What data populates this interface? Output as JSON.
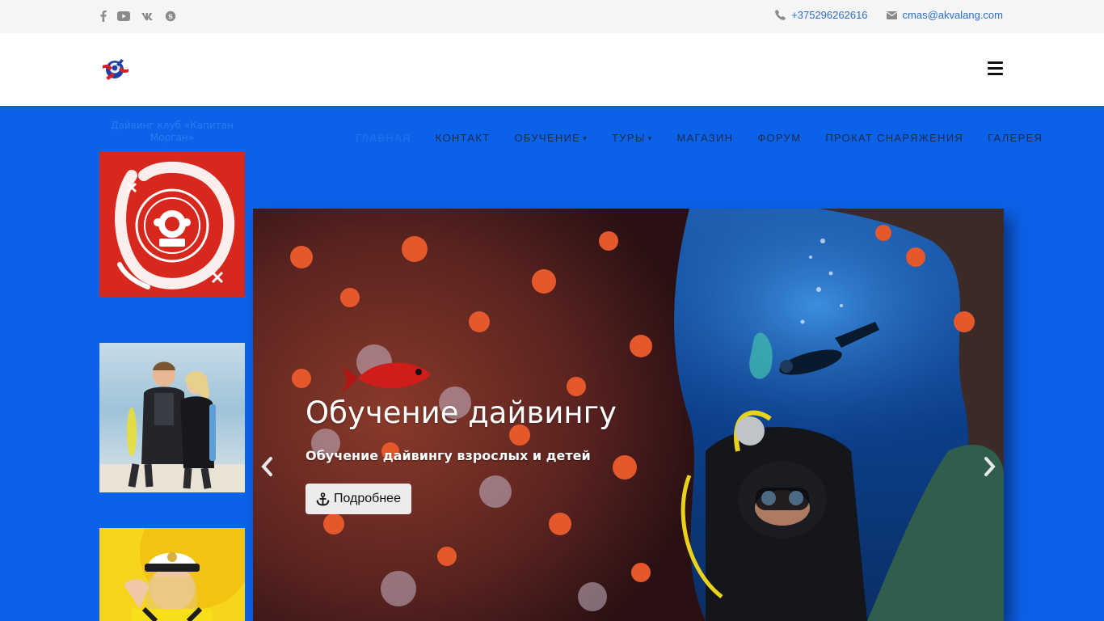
{
  "topbar": {
    "social": [
      "facebook-icon",
      "youtube-icon",
      "vk-icon",
      "skype-icon"
    ],
    "phone": "+375296262616",
    "email": "cmas@akvalang.com"
  },
  "header": {
    "menu_icon": "hamburger-icon"
  },
  "nav": {
    "items": [
      {
        "label": "ГЛАВНАЯ",
        "active": true
      },
      {
        "label": "КОНТАКТ"
      },
      {
        "label": "ОБУЧЕНИЕ",
        "dropdown": true
      },
      {
        "label": "ТУРЫ",
        "dropdown": true
      },
      {
        "label": "МАГАЗИН"
      },
      {
        "label": "ФОРУМ"
      },
      {
        "label": "ПРОКАТ СНАРЯЖЕНИЯ"
      },
      {
        "label": "ГАЛЕРЕЯ"
      }
    ]
  },
  "sidebar": {
    "caption": "Дайвинг клуб «Капитан Морган»",
    "logo_badge_text": "Белорусский подводный клуб КАПИТАН МОРГАН"
  },
  "slider": {
    "title": "Обучение дайвингу",
    "subtitle": "Обучение дайвингу взрослых и детей",
    "button_label": "Подробнее"
  },
  "colors": {
    "page_bg": "#0b62e8",
    "topbar_bg": "#f5f5f5",
    "link": "#2b6fc9",
    "badge_red": "#d8271d"
  }
}
